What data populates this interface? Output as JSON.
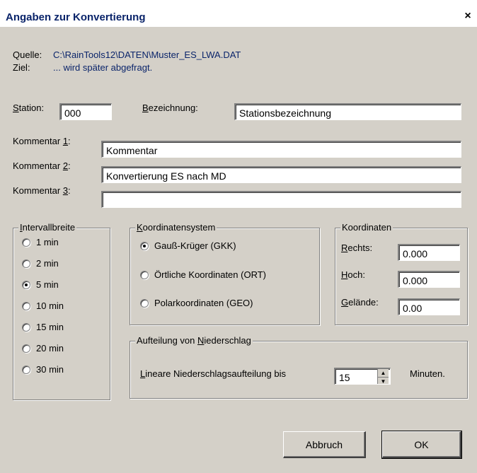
{
  "window": {
    "title": "Angaben zur Konvertierung",
    "close_glyph": "×"
  },
  "source": {
    "label": "Quelle:",
    "value": "C:\\RainTools12\\DATEN\\Muster_ES_LWA.DAT"
  },
  "target": {
    "label": "Ziel:",
    "value": "... wird später abgefragt."
  },
  "station": {
    "label": "Station:",
    "value": "000"
  },
  "bezeichnung": {
    "label": "Bezeichnung:",
    "value": "Stationsbezeichnung"
  },
  "comments": [
    {
      "label": "Kommentar 1:",
      "value": "Kommentar"
    },
    {
      "label": "Kommentar 2:",
      "value": "Konvertierung ES nach MD"
    },
    {
      "label": "Kommentar 3:",
      "value": ""
    }
  ],
  "interval": {
    "title": "Intervallbreite",
    "options": [
      "1 min",
      "2 min",
      "5 min",
      "10 min",
      "15 min",
      "20 min",
      "30 min"
    ],
    "selected": "5 min"
  },
  "coord_system": {
    "title": "Koordinatensystem",
    "options": [
      "Gauß-Krüger (GKK)",
      "Örtliche Koordinaten (ORT)",
      "Polarkoordinaten (GEO)"
    ],
    "selected": "Gauß-Krüger (GKK)"
  },
  "coordinates": {
    "title": "Koordinaten",
    "rechts": {
      "label": "Rechts:",
      "value": "0.000"
    },
    "hoch": {
      "label": "Hoch:",
      "value": "0.000"
    },
    "gelaende": {
      "label": "Gelände:",
      "value": "0.00"
    }
  },
  "precip": {
    "title": "Aufteilung von Niederschlag",
    "label": "Lineare Niederschlagsaufteilung bis",
    "value": "15",
    "unit": "Minuten."
  },
  "buttons": {
    "cancel": "Abbruch",
    "ok": "OK"
  },
  "colors": {
    "dialog_bg": "#d4d0c8",
    "title_text": "#0a246a",
    "path_text": "#0a246a"
  }
}
